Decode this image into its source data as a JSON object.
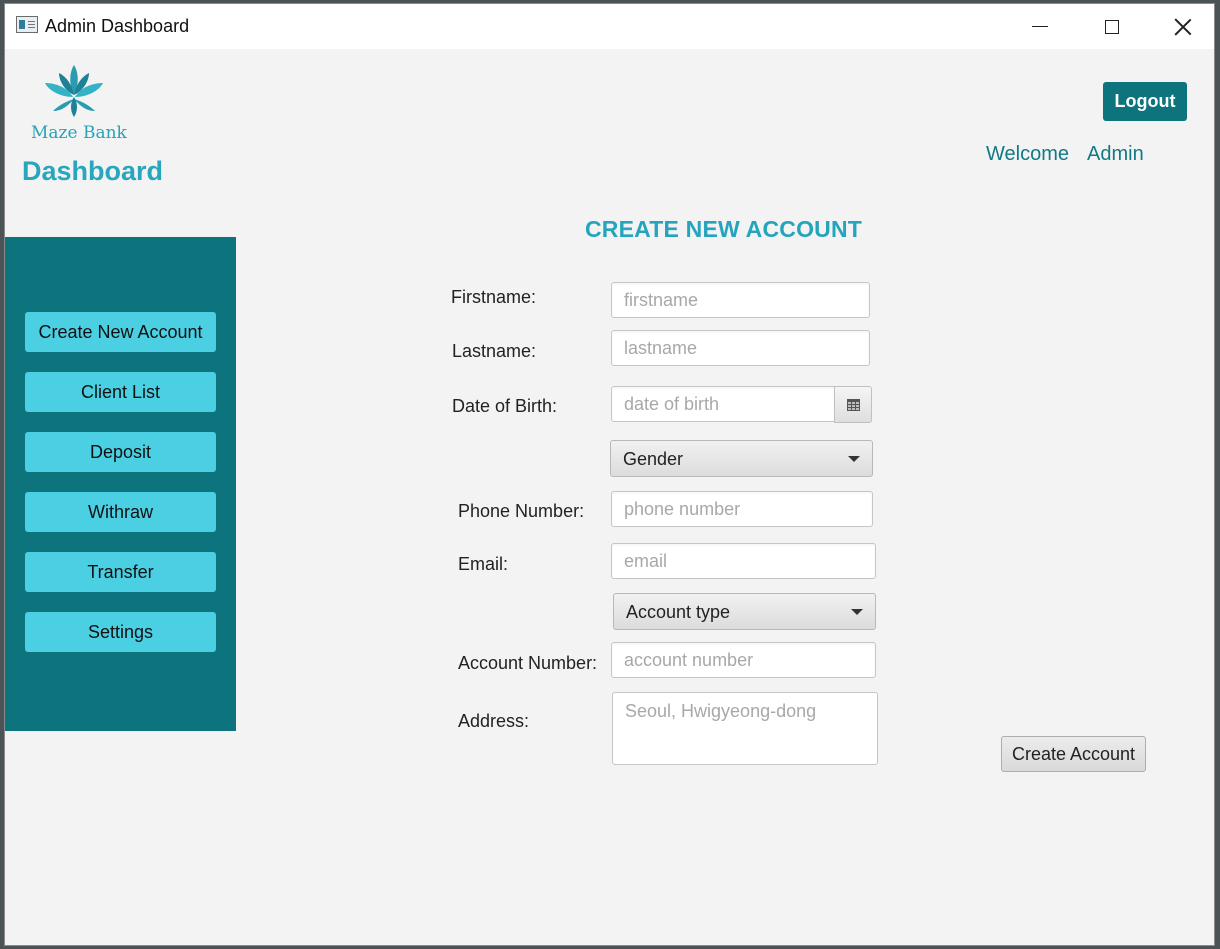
{
  "window": {
    "title": "Admin Dashboard",
    "icon": "app-window-icon"
  },
  "header": {
    "brand_name": "Maze Bank",
    "logo_icon": "lotus-logo-icon",
    "page_title": "Dashboard",
    "logout_label": "Logout",
    "welcome_label": "Welcome",
    "user_name": "Admin"
  },
  "colors": {
    "accent_dark": "#0d737c",
    "accent_light": "#4bcfe3",
    "title_blue": "#24a5bd"
  },
  "sidebar": {
    "items": [
      {
        "label": "Create New Account"
      },
      {
        "label": "Client List"
      },
      {
        "label": "Deposit"
      },
      {
        "label": "Withraw"
      },
      {
        "label": "Transfer"
      },
      {
        "label": "Settings"
      }
    ]
  },
  "form": {
    "title": "CREATE NEW ACCOUNT",
    "firstname": {
      "label": "Firstname:",
      "placeholder": "firstname",
      "value": ""
    },
    "lastname": {
      "label": "Lastname:",
      "placeholder": "lastname",
      "value": ""
    },
    "dob": {
      "label": "Date of Birth:",
      "placeholder": "date of birth",
      "value": "",
      "icon": "calendar-icon"
    },
    "gender": {
      "selected": "Gender"
    },
    "phone": {
      "label": "Phone Number:",
      "placeholder": "phone number",
      "value": ""
    },
    "email": {
      "label": "Email:",
      "placeholder": "email",
      "value": ""
    },
    "account_type": {
      "selected": "Account type"
    },
    "account_number": {
      "label": "Account Number:",
      "placeholder": "account number",
      "value": ""
    },
    "address": {
      "label": "Address:",
      "placeholder": "Seoul, Hwigyeong-dong",
      "value": ""
    },
    "submit_label": "Create Account"
  }
}
